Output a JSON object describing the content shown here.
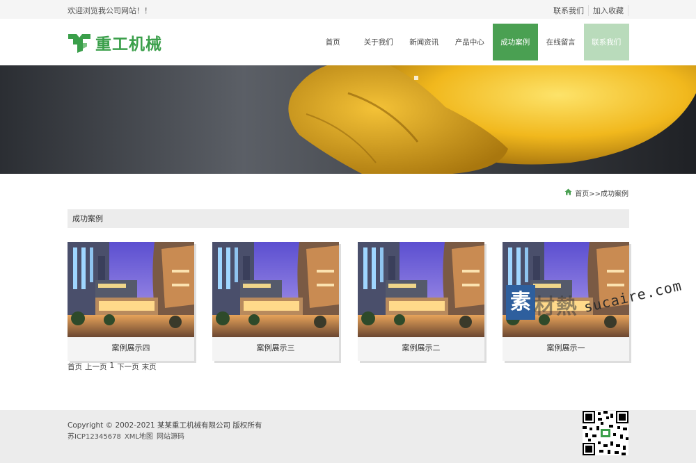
{
  "topbar": {
    "welcome": "欢迎浏览我公司网站！！",
    "links": [
      "联系我们",
      "加入收藏"
    ]
  },
  "header": {
    "logo_text": "重工机械",
    "brand_color": "#3a9f4a",
    "nav": [
      "首页",
      "关于我们",
      "新闻资讯",
      "产品中心",
      "成功案例",
      "在线留言",
      "联系我们"
    ],
    "active_nav": "成功案例"
  },
  "breadcrumb": {
    "text": "首页>>成功案例"
  },
  "section": {
    "title": "成功案例"
  },
  "cases": [
    {
      "caption": "案例展示四"
    },
    {
      "caption": "案例展示三"
    },
    {
      "caption": "案例展示二"
    },
    {
      "caption": "案例展示一"
    }
  ],
  "pager": [
    "首页",
    "上一页",
    "1",
    "下一页",
    "末页"
  ],
  "watermark": {
    "badge": "素",
    "cjk": "材熱",
    "latin": "sucaire.com"
  },
  "footer": {
    "copyright": "Copyright © 2002-2021 某某重工机械有限公司 版权所有",
    "icp": "苏ICP12345678",
    "links": [
      "XML地图",
      "网站源码"
    ]
  }
}
